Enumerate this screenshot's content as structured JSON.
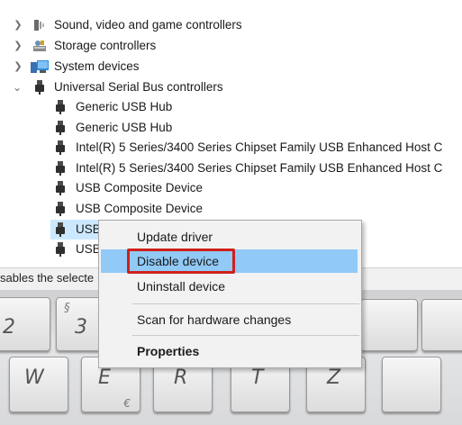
{
  "tree": {
    "categories": [
      {
        "label": "Sound, video and game controllers",
        "icon": "speaker-icon",
        "expanded": false
      },
      {
        "label": "Storage controllers",
        "icon": "storage-controller-icon",
        "expanded": false
      },
      {
        "label": "System devices",
        "icon": "system-devices-icon",
        "expanded": false
      },
      {
        "label": "Universal Serial Bus controllers",
        "icon": "usb-icon",
        "expanded": true
      }
    ],
    "usb_devices": [
      {
        "label": "Generic USB Hub"
      },
      {
        "label": "Generic USB Hub"
      },
      {
        "label": "Intel(R) 5 Series/3400 Series Chipset Family USB Enhanced Host C"
      },
      {
        "label": "Intel(R) 5 Series/3400 Series Chipset Family USB Enhanced Host C"
      },
      {
        "label": "USB Composite Device"
      },
      {
        "label": "USB Composite Device"
      },
      {
        "label": "USB",
        "selected": true
      },
      {
        "label": "USB"
      }
    ]
  },
  "status_bar": {
    "text": "sables the selecte"
  },
  "context_menu": {
    "items": [
      {
        "label": "Update driver"
      },
      {
        "label": "Disable device",
        "highlighted": true
      },
      {
        "label": "Uninstall device"
      },
      {
        "label": "Scan for hardware changes"
      },
      {
        "label": "Properties",
        "bold": true
      }
    ]
  },
  "keyboard_keys": [
    {
      "main": "2",
      "sub": ""
    },
    {
      "main": "3",
      "sub": "§"
    },
    {
      "main": "W",
      "sub": ""
    },
    {
      "main": "E",
      "sub": "",
      "alt": "€"
    },
    {
      "main": "R",
      "sub": ""
    },
    {
      "main": "T",
      "sub": ""
    },
    {
      "main": "Z",
      "sub": ""
    }
  ],
  "colors": {
    "selection": "#cce8ff",
    "menu_highlight": "#91c9f7",
    "annotation_box": "#d0201a"
  }
}
